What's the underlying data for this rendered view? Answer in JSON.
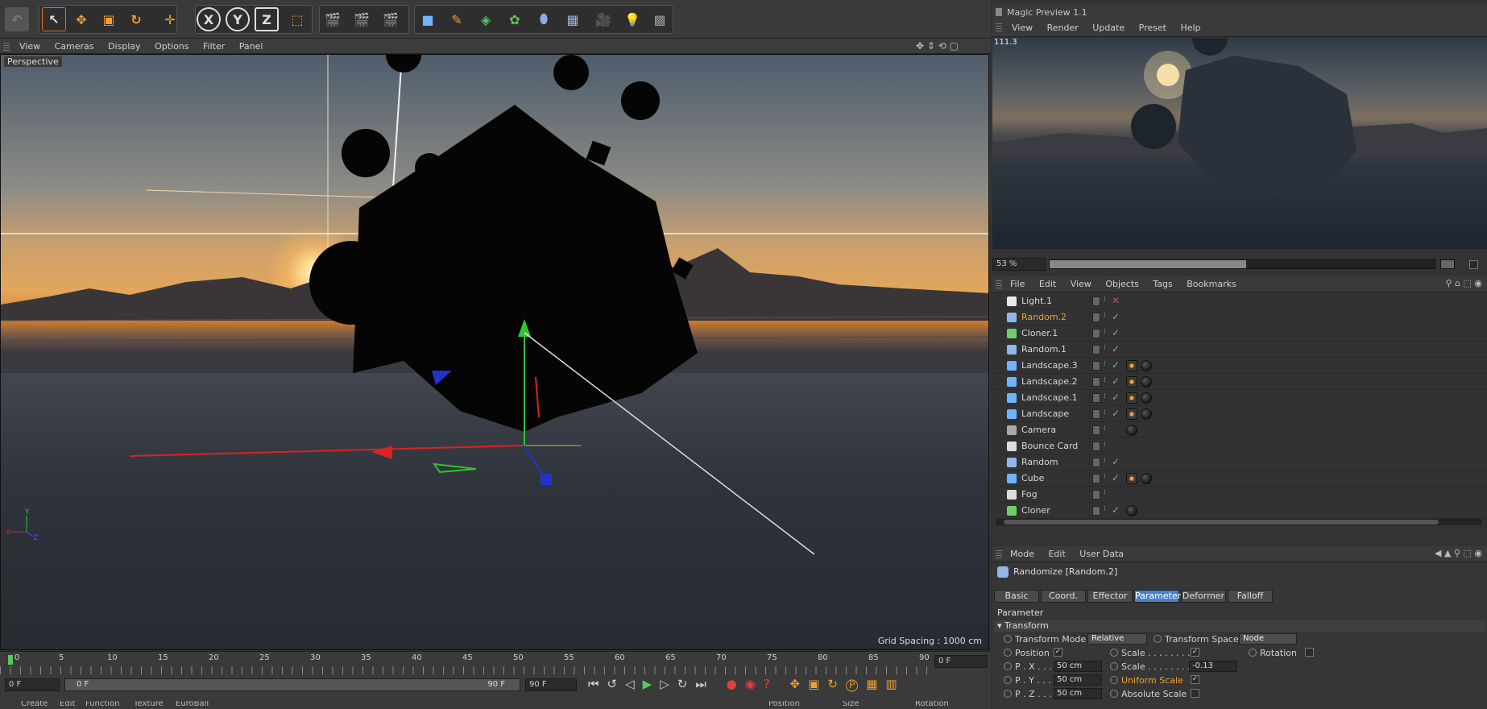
{
  "viewport_menu": [
    "View",
    "Cameras",
    "Display",
    "Options",
    "Filter",
    "Panel"
  ],
  "viewport_label": "Perspective",
  "grid_spacing": "Grid Spacing : 1000 cm",
  "toolbar_axes": [
    "X",
    "Y",
    "Z"
  ],
  "timeline_ticks": [
    "0",
    "5",
    "10",
    "15",
    "20",
    "25",
    "30",
    "35",
    "40",
    "45",
    "50",
    "55",
    "60",
    "65",
    "70",
    "75",
    "80",
    "85",
    "90"
  ],
  "timeline": {
    "current_frame": "0 F",
    "start_frame": "0 F",
    "range_start": "0 F",
    "range_end": "90 F",
    "end_frame": "90 F"
  },
  "bottom_menu": [
    "Create",
    "Edit",
    "Function",
    "Texture",
    "EuroBall"
  ],
  "bottom_right": [
    "Position",
    "Size",
    "Rotation"
  ],
  "magic_preview": {
    "title": "Magic Preview 1.1",
    "menu": [
      "View",
      "Render",
      "Update",
      "Preset",
      "Help"
    ],
    "corner_label": "111.3",
    "zoom": "53 %",
    "progress": 0.51
  },
  "object_manager": {
    "menu": [
      "File",
      "Edit",
      "View",
      "Objects",
      "Tags",
      "Bookmarks"
    ],
    "objects": [
      {
        "name": "Light.1",
        "status": "x",
        "selected": false,
        "icon_color": "#e8e8e8"
      },
      {
        "name": "Random.2",
        "status": "check",
        "selected": true,
        "icon_color": "#8fb8e8"
      },
      {
        "name": "Cloner.1",
        "status": "check",
        "selected": false,
        "icon_color": "#6fcf6f"
      },
      {
        "name": "Random.1",
        "status": "check",
        "selected": false,
        "icon_color": "#8fb8e8"
      },
      {
        "name": "Landscape.3",
        "status": "check",
        "selected": false,
        "icon_color": "#6fb4ff"
      },
      {
        "name": "Landscape.2",
        "status": "check",
        "selected": false,
        "icon_color": "#6fb4ff"
      },
      {
        "name": "Landscape.1",
        "status": "check",
        "selected": false,
        "icon_color": "#6fb4ff"
      },
      {
        "name": "Landscape",
        "status": "check",
        "selected": false,
        "icon_color": "#6fb4ff"
      },
      {
        "name": "Camera",
        "status": "none",
        "selected": false,
        "icon_color": "#aaaaaa"
      },
      {
        "name": "Bounce Card",
        "status": "none",
        "selected": false,
        "icon_color": "#dddddd"
      },
      {
        "name": "Random",
        "status": "check",
        "selected": false,
        "icon_color": "#8fb8e8"
      },
      {
        "name": "Cube",
        "status": "check",
        "selected": false,
        "icon_color": "#6fb4ff"
      },
      {
        "name": "Fog",
        "status": "none",
        "selected": false,
        "icon_color": "#dddddd"
      },
      {
        "name": "Cloner",
        "status": "check",
        "selected": false,
        "icon_color": "#6fcf6f"
      }
    ]
  },
  "attributes": {
    "menu": [
      "Mode",
      "Edit",
      "User Data"
    ],
    "object_title": "Randomize [Random.2]",
    "tabs": [
      "Basic",
      "Coord.",
      "Effector",
      "Parameter",
      "Deformer",
      "Falloff"
    ],
    "active_tab": "Parameter",
    "section_parameter": "Parameter",
    "section_transform": "Transform",
    "transform_mode_label": "Transform Mode",
    "transform_mode_value": "Relative",
    "transform_space_label": "Transform Space",
    "transform_space_value": "Node",
    "position_label": "Position",
    "scale_label": "Scale . . . . . . . .",
    "rotation_label": "Rotation",
    "px_label": "P . X . . . . . .",
    "px_value": "50 cm",
    "py_label": "P . Y . . . . . .",
    "py_value": "50 cm",
    "pz_label": "P . Z . . . . . .",
    "pz_value": "50 cm",
    "scale_field_label": "Scale . . . . . . . .",
    "scale_value": "-0.13",
    "uniform_scale_label": "Uniform Scale",
    "absolute_scale_label": "Absolute Scale"
  },
  "colors": {
    "accent_blue": "#4c82c8",
    "selected_orange": "#f0a030",
    "check_green": "#5ac85a",
    "x_red": "#e04040"
  }
}
